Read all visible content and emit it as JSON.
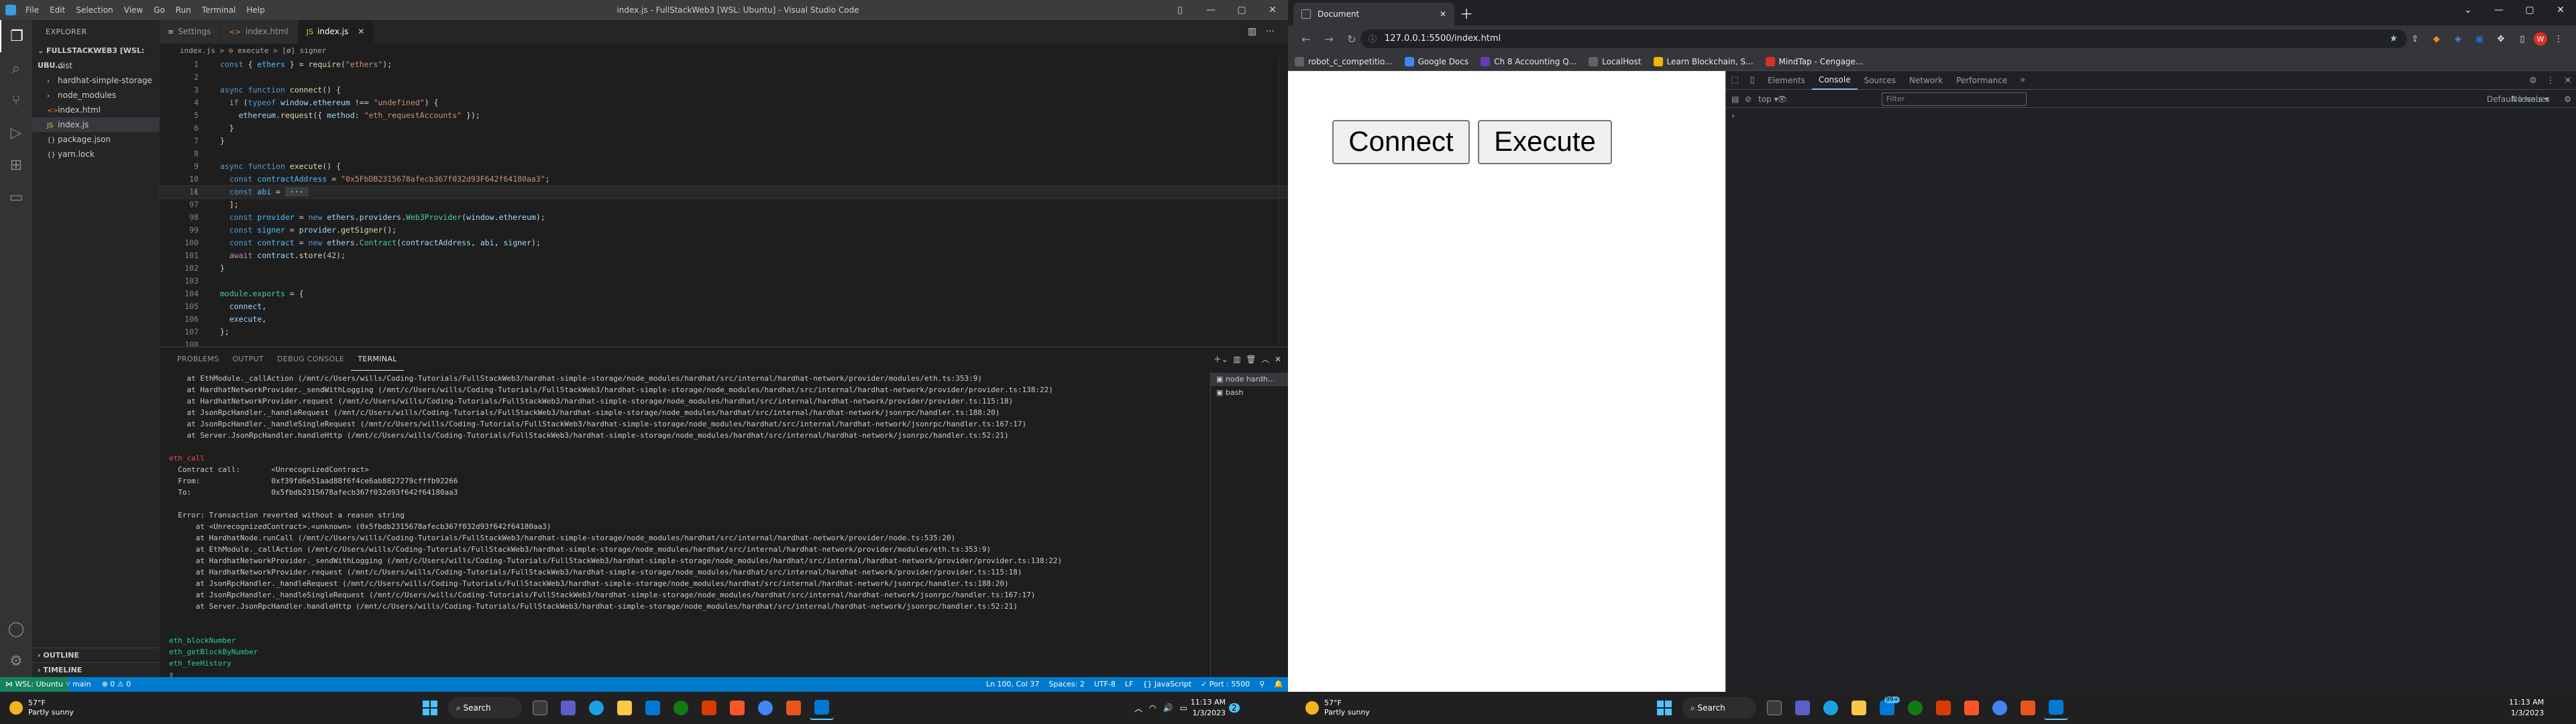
{
  "vscode": {
    "window_title": "index.js - FullStackWeb3 [WSL: Ubuntu] - Visual Studio Code",
    "menu": [
      "File",
      "Edit",
      "Selection",
      "View",
      "Go",
      "Run",
      "Terminal",
      "Help"
    ],
    "explorer": {
      "header": "EXPLORER",
      "project": "FULLSTACKWEB3 [WSL: UBU...",
      "items": [
        {
          "label": "dist",
          "type": "folder"
        },
        {
          "label": "hardhat-simple-storage",
          "type": "folder"
        },
        {
          "label": "node_modules",
          "type": "folder"
        },
        {
          "label": "index.html",
          "type": "file"
        },
        {
          "label": "index.js",
          "type": "file"
        },
        {
          "label": "package.json",
          "type": "file"
        },
        {
          "label": "yarn.lock",
          "type": "file"
        }
      ],
      "outline": "OUTLINE",
      "timeline": "TIMELINE"
    },
    "tabs": [
      {
        "label": "Settings",
        "icon": "≡"
      },
      {
        "label": "index.html",
        "icon": "<>"
      },
      {
        "label": "index.js",
        "icon": "JS"
      }
    ],
    "breadcrumb": "index.js > ⊙ execute > [ø] signer",
    "code_lines": [
      {
        "ln": "1",
        "html": "<span class='k'>const</span> <span class='p'>{ </span><span class='v'>ethers</span><span class='p'> } = </span><span class='f'>require</span><span class='p'>(</span><span class='s'>\"ethers\"</span><span class='p'>);</span>"
      },
      {
        "ln": "2",
        "html": ""
      },
      {
        "ln": "3",
        "html": "<span class='k'>async</span> <span class='k'>function</span> <span class='f'>connect</span><span class='p'>() {</span>"
      },
      {
        "ln": "4",
        "html": "  <span class='kc'>if</span><span class='p'> (</span><span class='k'>typeof</span> <span class='vv'>window</span><span class='p'>.</span><span class='vv'>ethereum</span><span class='p'> !== </span><span class='s'>\"undefined\"</span><span class='p'>) {</span>"
      },
      {
        "ln": "5",
        "html": "    <span class='vv'>ethereum</span><span class='p'>.</span><span class='f'>request</span><span class='p'>({ </span><span class='vv'>method</span><span class='p'>: </span><span class='s'>\"eth_requestAccounts\"</span><span class='p'> });</span>"
      },
      {
        "ln": "6",
        "html": "  <span class='p'>}</span>"
      },
      {
        "ln": "7",
        "html": "<span class='p'>}</span>"
      },
      {
        "ln": "8",
        "html": ""
      },
      {
        "ln": "9",
        "html": "<span class='k'>async</span> <span class='k'>function</span> <span class='f'>execute</span><span class='p'>() {</span>"
      },
      {
        "ln": "10",
        "html": "  <span class='k'>const</span> <span class='v'>contractAddress</span><span class='p'> = </span><span class='s'>\"0x5FbDB2315678afecb367f032d93F642f64180aa3\"</span><span class='p'>;</span>"
      },
      {
        "ln": "11",
        "html": "  <span class='k'>const</span> <span class='v'>abi</span><span class='p'> = </span><span class='p' style='background:#3a3d41'> ··· </span>",
        "cur": true,
        "fold": true
      },
      {
        "ln": "97",
        "html": "  <span class='p'>];</span>"
      },
      {
        "ln": "98",
        "html": "  <span class='k'>const</span> <span class='v'>provider</span><span class='p'> = </span><span class='k'>new</span> <span class='vv'>ethers</span><span class='p'>.</span><span class='vv'>providers</span><span class='p'>.</span><span class='t'>Web3Provider</span><span class='p'>(</span><span class='vv'>window</span><span class='p'>.</span><span class='vv'>ethereum</span><span class='p'>);</span>"
      },
      {
        "ln": "99",
        "html": "  <span class='k'>const</span> <span class='v'>signer</span><span class='p'> = </span><span class='vv'>provider</span><span class='p'>.</span><span class='f'>getSigner</span><span class='p'>();</span>"
      },
      {
        "ln": "100",
        "html": "  <span class='k'>const</span> <span class='v'>contract</span><span class='p'> = </span><span class='k'>new</span> <span class='vv'>ethers</span><span class='p'>.</span><span class='t'>Contract</span><span class='p'>(</span><span class='vv'>contractAddress</span><span class='p'>, </span><span class='vv'>abi</span><span class='p'>, </span><span class='vv'>signer</span><span class='p'>);</span>"
      },
      {
        "ln": "101",
        "html": "  <span class='kc'>await</span> <span class='vv'>contract</span><span class='p'>.</span><span class='f'>store</span><span class='p'>(</span><span class='n'>42</span><span class='p'>);</span>"
      },
      {
        "ln": "102",
        "html": "<span class='p'>}</span>"
      },
      {
        "ln": "103",
        "html": ""
      },
      {
        "ln": "104",
        "html": "<span class='t'>module</span><span class='p'>.</span><span class='t'>exports</span><span class='p'> = {</span>"
      },
      {
        "ln": "105",
        "html": "  <span class='vv'>connect</span><span class='p'>,</span>"
      },
      {
        "ln": "106",
        "html": "  <span class='vv'>execute</span><span class='p'>,</span>"
      },
      {
        "ln": "107",
        "html": "<span class='p'>};</span>"
      },
      {
        "ln": "108",
        "html": ""
      }
    ],
    "panel": {
      "tabs": [
        "PROBLEMS",
        "OUTPUT",
        "DEBUG CONSOLE",
        "TERMINAL"
      ],
      "active": "TERMINAL",
      "terminal_list": [
        "node hardh...",
        "bash"
      ]
    },
    "terminal_lines": [
      {
        "c": "",
        "t": "    at EthModule._callAction (/mnt/c/Users/wills/Coding-Tutorials/FullStackWeb3/hardhat-simple-storage/node_modules/hardhat/src/internal/hardhat-network/provider/modules/eth.ts:353:9)"
      },
      {
        "c": "",
        "t": "    at HardhatNetworkProvider._sendWithLogging (/mnt/c/Users/wills/Coding-Tutorials/FullStackWeb3/hardhat-simple-storage/node_modules/hardhat/src/internal/hardhat-network/provider/provider.ts:138:22)"
      },
      {
        "c": "",
        "t": "    at HardhatNetworkProvider.request (/mnt/c/Users/wills/Coding-Tutorials/FullStackWeb3/hardhat-simple-storage/node_modules/hardhat/src/internal/hardhat-network/provider/provider.ts:115:18)"
      },
      {
        "c": "",
        "t": "    at JsonRpcHandler._handleRequest (/mnt/c/Users/wills/Coding-Tutorials/FullStackWeb3/hardhat-simple-storage/node_modules/hardhat/src/internal/hardhat-network/jsonrpc/handler.ts:188:20)"
      },
      {
        "c": "",
        "t": "    at JsonRpcHandler._handleSingleRequest (/mnt/c/Users/wills/Coding-Tutorials/FullStackWeb3/hardhat-simple-storage/node_modules/hardhat/src/internal/hardhat-network/jsonrpc/handler.ts:167:17)"
      },
      {
        "c": "",
        "t": "    at Server.JsonRpcHandler.handleHttp (/mnt/c/Users/wills/Coding-Tutorials/FullStackWeb3/hardhat-simple-storage/node_modules/hardhat/src/internal/hardhat-network/jsonrpc/handler.ts:52:21)"
      },
      {
        "c": "",
        "t": ""
      },
      {
        "c": "r",
        "t": "eth_call"
      },
      {
        "c": "",
        "t": "  Contract call:       <UnrecognizedContract>"
      },
      {
        "c": "",
        "t": "  From:                0xf39fd6e51aad88f6f4ce6ab8827279cfffb92266"
      },
      {
        "c": "",
        "t": "  To:                  0x5fbdb2315678afecb367f032d93f642f64180aa3"
      },
      {
        "c": "",
        "t": ""
      },
      {
        "c": "",
        "t": "  Error: Transaction reverted without a reason string"
      },
      {
        "c": "",
        "t": "      at <UnrecognizedContract>.<unknown> (0x5fbdb2315678afecb367f032d93f642f64180aa3)"
      },
      {
        "c": "",
        "t": "      at HardhatNode.runCall (/mnt/c/Users/wills/Coding-Tutorials/FullStackWeb3/hardhat-simple-storage/node_modules/hardhat/src/internal/hardhat-network/provider/node.ts:535:20)"
      },
      {
        "c": "",
        "t": "      at EthModule._callAction (/mnt/c/Users/wills/Coding-Tutorials/FullStackWeb3/hardhat-simple-storage/node_modules/hardhat/src/internal/hardhat-network/provider/modules/eth.ts:353:9)"
      },
      {
        "c": "",
        "t": "      at HardhatNetworkProvider._sendWithLogging (/mnt/c/Users/wills/Coding-Tutorials/FullStackWeb3/hardhat-simple-storage/node_modules/hardhat/src/internal/hardhat-network/provider/provider.ts:138:22)"
      },
      {
        "c": "",
        "t": "      at HardhatNetworkProvider.request (/mnt/c/Users/wills/Coding-Tutorials/FullStackWeb3/hardhat-simple-storage/node_modules/hardhat/src/internal/hardhat-network/provider/provider.ts:115:18)"
      },
      {
        "c": "",
        "t": "      at JsonRpcHandler._handleRequest (/mnt/c/Users/wills/Coding-Tutorials/FullStackWeb3/hardhat-simple-storage/node_modules/hardhat/src/internal/hardhat-network/jsonrpc/handler.ts:188:20)"
      },
      {
        "c": "",
        "t": "      at JsonRpcHandler._handleSingleRequest (/mnt/c/Users/wills/Coding-Tutorials/FullStackWeb3/hardhat-simple-storage/node_modules/hardhat/src/internal/hardhat-network/jsonrpc/handler.ts:167:17)"
      },
      {
        "c": "",
        "t": "      at Server.JsonRpcHandler.handleHttp (/mnt/c/Users/wills/Coding-Tutorials/FullStackWeb3/hardhat-simple-storage/node_modules/hardhat/src/internal/hardhat-network/jsonrpc/handler.ts:52:21)"
      },
      {
        "c": "",
        "t": ""
      },
      {
        "c": "",
        "t": ""
      },
      {
        "c": "g",
        "t": "eth_blockNumber"
      },
      {
        "c": "g",
        "t": "eth_getBlockByNumber"
      },
      {
        "c": "g",
        "t": "eth_feeHistory"
      },
      {
        "c": "",
        "t": "▯"
      }
    ],
    "status": {
      "remote": "⋈ WSL: Ubuntu",
      "left": [
        "⑂ main",
        "⊗ 0 ⚠ 0"
      ],
      "right": [
        "Ln 100, Col 37",
        "Spaces: 2",
        "UTF-8",
        "LF",
        "{} JavaScript",
        "✓ Port : 5500",
        "⚲",
        "🔔"
      ]
    }
  },
  "chrome": {
    "tab_title": "Document",
    "url": "127.0.0.1:5500/index.html",
    "bookmarks": [
      {
        "label": "robot_c_competitio...",
        "color": "#5f6368"
      },
      {
        "label": "Google Docs",
        "color": "#4285f4"
      },
      {
        "label": "Ch 8 Accounting Q...",
        "color": "#673ab7"
      },
      {
        "label": "LocalHost",
        "color": "#5f6368"
      },
      {
        "label": "Learn Blockchain, S...",
        "color": "#f4b400"
      },
      {
        "label": "MindTap - Cengage...",
        "color": "#d93025"
      }
    ],
    "page_buttons": [
      "Connect",
      "Execute"
    ],
    "devtools": {
      "tabs": [
        "Elements",
        "Console",
        "Sources",
        "Network",
        "Performance"
      ],
      "active": "Console",
      "context": "top",
      "filter_placeholder": "Filter",
      "levels": "Default levels ▾",
      "issues": "No Issues",
      "prompt": "›"
    },
    "profile_initial": "W"
  },
  "taskbar": {
    "left_weather": {
      "temp": "57°F",
      "desc": "Partly sunny"
    },
    "right_weather": {
      "temp": "57°F",
      "desc": "Partly sunny"
    },
    "search_label": "Search",
    "left_clock": {
      "time": "11:13 AM",
      "date": "1/3/2023"
    },
    "right_clock": {
      "time": "11:13 AM",
      "date": "1/3/2023"
    },
    "left_badge": "2",
    "teams_badge": "99+"
  }
}
